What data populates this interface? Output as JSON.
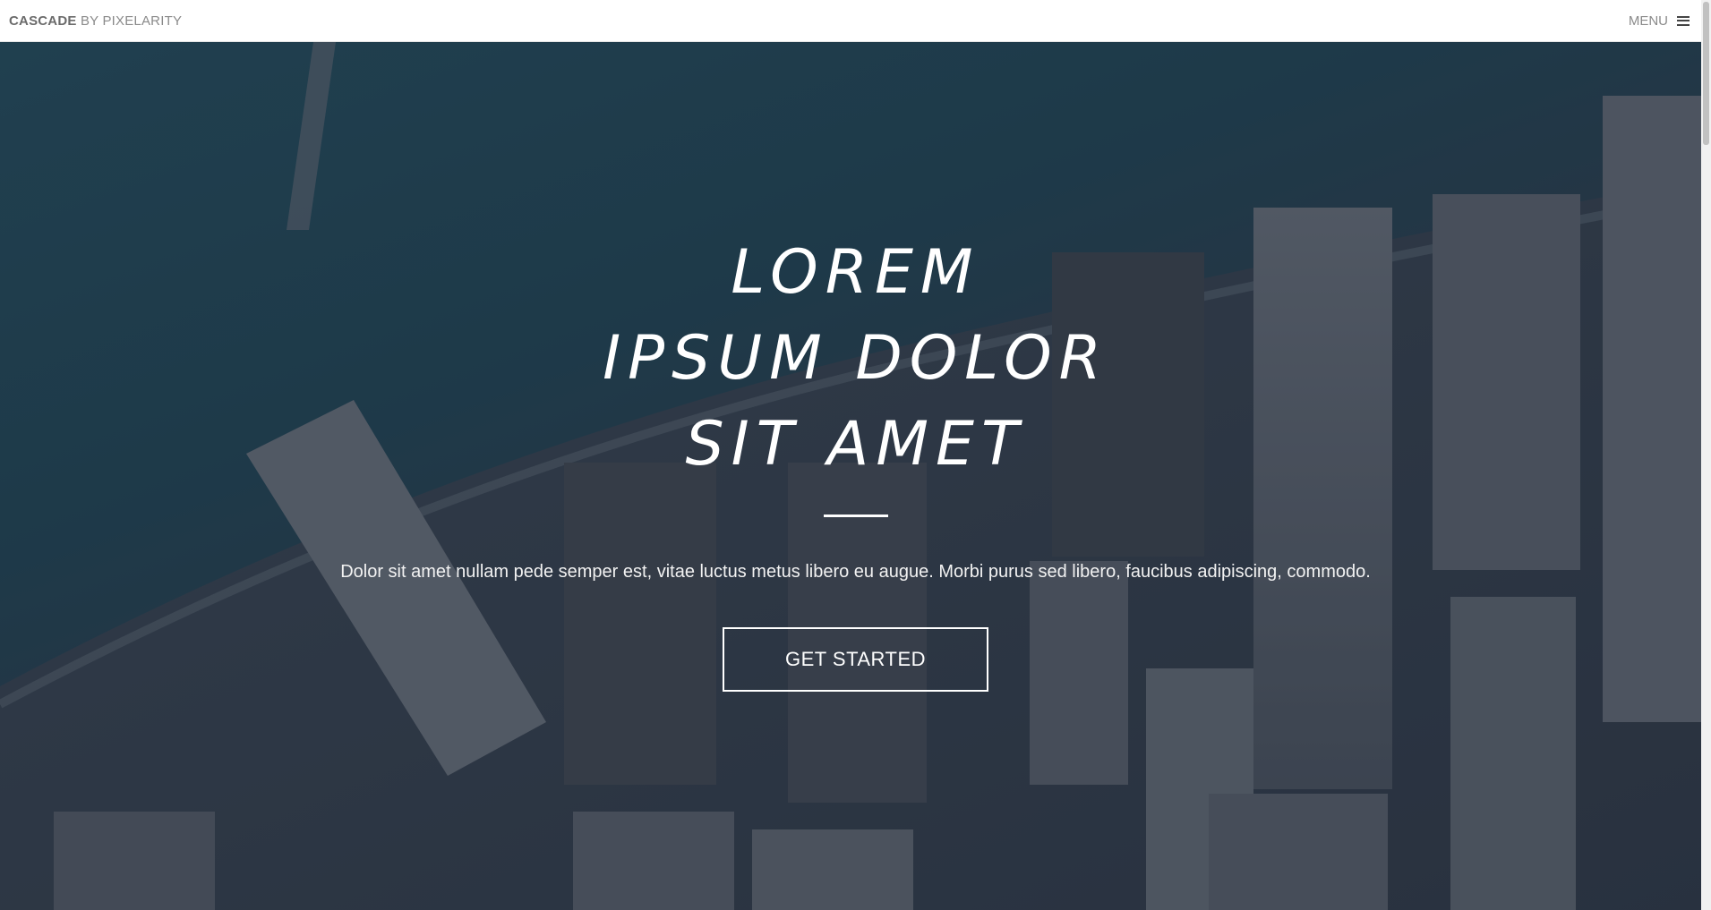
{
  "header": {
    "brand_bold": "CASCADE",
    "brand_rest": " BY PIXELARITY",
    "menu_label": "MENU",
    "menu_icon": "hamburger-icon"
  },
  "hero": {
    "title_lines": [
      "LOREM",
      "IPSUM DOLOR",
      "SIT AMET"
    ],
    "tagline": "Dolor sit amet nullam pede semper est, vitae luctus metus libero eu augue. Morbi purus sed libero, faucibus adipiscing, commodo.",
    "cta_label": "GET STARTED"
  },
  "colors": {
    "header_bg": "#ffffff",
    "hero_text": "#ffffff",
    "water": "#1f4a5a",
    "overlay": "#2d3645"
  }
}
